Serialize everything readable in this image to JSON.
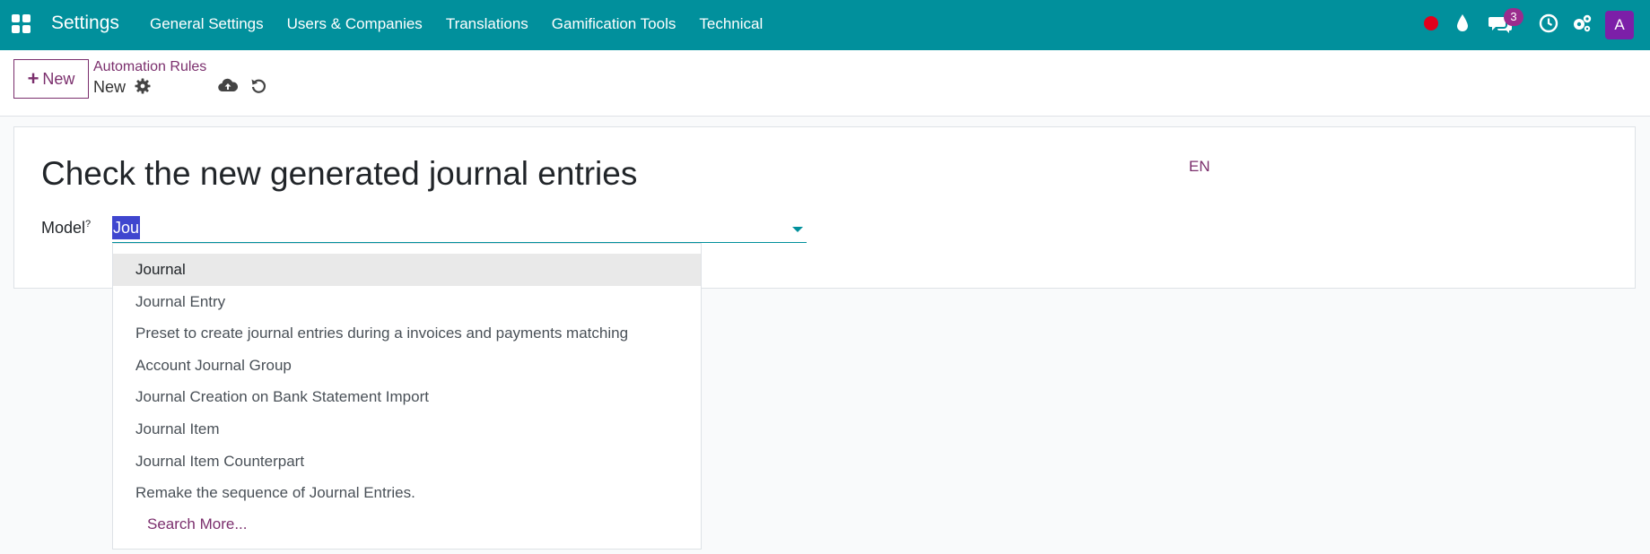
{
  "navbar": {
    "brand": "Settings",
    "menu": [
      "General Settings",
      "Users & Companies",
      "Translations",
      "Gamification Tools",
      "Technical"
    ],
    "chat_badge": "3",
    "avatar_letter": "A",
    "colors": {
      "bar": "#01909c",
      "record": "#e3001b",
      "badge": "#9b2c8d",
      "avatar": "#7c1fa8"
    }
  },
  "control": {
    "new_label": "New",
    "breadcrumb_parent": "Automation Rules",
    "breadcrumb_current": "New"
  },
  "form": {
    "title": "Check the new generated journal entries",
    "lang": "EN",
    "model_label": "Model",
    "model_help": "?",
    "model_value": "Jou"
  },
  "dropdown": {
    "items": [
      "Journal",
      "Journal Entry",
      "Preset to create journal entries during a invoices and payments matching",
      "Account Journal Group",
      "Journal Creation on Bank Statement Import",
      "Journal Item",
      "Journal Item Counterpart",
      "Remake the sequence of Journal Entries."
    ],
    "search_more": "Search More..."
  }
}
